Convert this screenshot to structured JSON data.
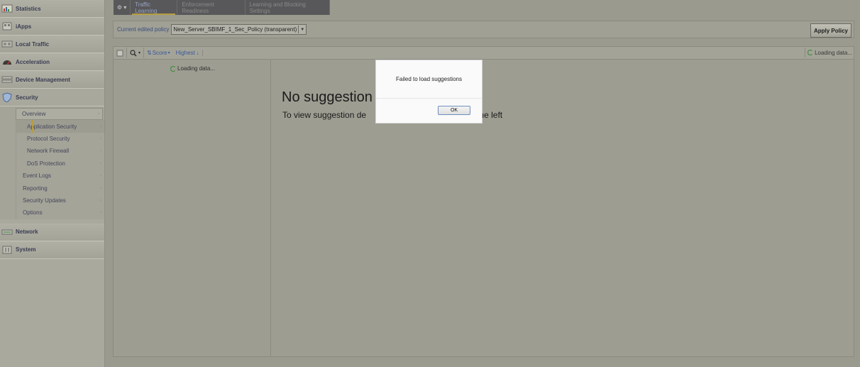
{
  "sidebar": {
    "items": [
      {
        "label": "Statistics",
        "icon": "chart-icon"
      },
      {
        "label": "iApps",
        "icon": "apps-icon"
      },
      {
        "label": "Local Traffic",
        "icon": "network-globe-icon"
      },
      {
        "label": "Acceleration",
        "icon": "gauge-icon"
      },
      {
        "label": "Device Management",
        "icon": "device-icon"
      },
      {
        "label": "Security",
        "icon": "shield-icon"
      }
    ],
    "security_submenu": {
      "overview": "Overview",
      "children": [
        "Application Security",
        "Protocol Security",
        "Network Firewall",
        "DoS Protection"
      ],
      "rest": [
        "Event Logs",
        "Reporting",
        "Security Updates",
        "Options"
      ]
    },
    "bottom_items": [
      {
        "label": "Network",
        "icon": "network-icon"
      },
      {
        "label": "System",
        "icon": "system-icon"
      }
    ],
    "caret": "›"
  },
  "tabs": {
    "menu_glyph": "⚙ ▾",
    "items": [
      "Traffic Learning",
      "Enforcement Readiness",
      "Learning and Blocking Settings"
    ]
  },
  "policybar": {
    "label": "Current edited policy",
    "value": "New_Server_SBIMF_1_Sec_Policy (transparent)",
    "apply": "Apply Policy"
  },
  "toolbar": {
    "sort": "Score",
    "order": "Highest",
    "loading": "Loading data..."
  },
  "leftpane": {
    "loading": "Loading data..."
  },
  "rightpane": {
    "heading": "No suggestion s",
    "heading_tail": "",
    "subtext_start": "To view suggestion de",
    "subtext_end": "ist on the left"
  },
  "dialog": {
    "message": "Failed to load suggestions",
    "ok": "OK"
  },
  "colors": {
    "accent": "#b79e3e",
    "link": "#3c5a9a",
    "spinner": "#3a8a34"
  }
}
